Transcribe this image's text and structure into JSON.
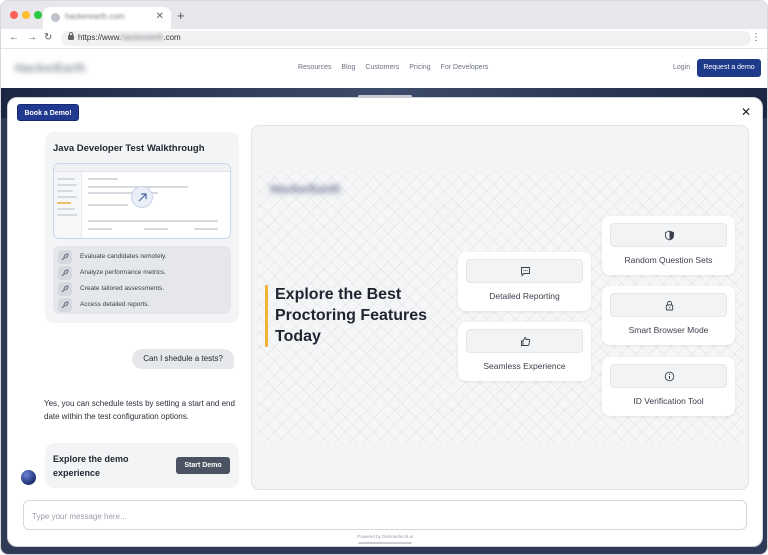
{
  "browser": {
    "tab_title": "hackerearth.com",
    "url_prefix": "https://www.",
    "url_domain": "hackerearth",
    "url_suffix": ".com",
    "traffic_light_colors": [
      "#ff5f57",
      "#febc2e",
      "#28c840"
    ]
  },
  "site": {
    "logo": "HackerEarth",
    "nav": [
      "Resources",
      "Blog",
      "Customers",
      "Pricing",
      "For Developers"
    ],
    "login_label": "Login",
    "request_demo_label": "Request a demo",
    "brand_color": "#1e3a8a"
  },
  "modal": {
    "book_demo_label": "Book a Demo!",
    "walkthrough": {
      "title": "Java Developer Test Walkthrough",
      "features": [
        "Evaluate candidates remotely.",
        "Analyze performance metrics.",
        "Create tailored assessments.",
        "Access detailed reports."
      ]
    },
    "user_message": "Can I shedule a tests?",
    "bot_message": "Yes, you can schedule tests by setting a start and end date within the test configuration options.",
    "demo_card": {
      "text": "Explore the demo experience",
      "button_label": "Start Demo"
    },
    "preview": {
      "logo": "HackerEarth",
      "headline": "Explore the Best Proctoring Features Today",
      "accent_color": "#f2b233",
      "features": [
        {
          "label": "Detailed Reporting",
          "icon": "chat-icon"
        },
        {
          "label": "Seamless Experience",
          "icon": "thumbs-up-icon"
        },
        {
          "label": "Random Question Sets",
          "icon": "shield-icon"
        },
        {
          "label": "Smart Browser Mode",
          "icon": "lock-icon"
        },
        {
          "label": "ID Verification Tool",
          "icon": "info-icon"
        }
      ]
    },
    "message_placeholder": "Type your message here...",
    "powered_by": "Powered by Delonaidecol.ai"
  }
}
